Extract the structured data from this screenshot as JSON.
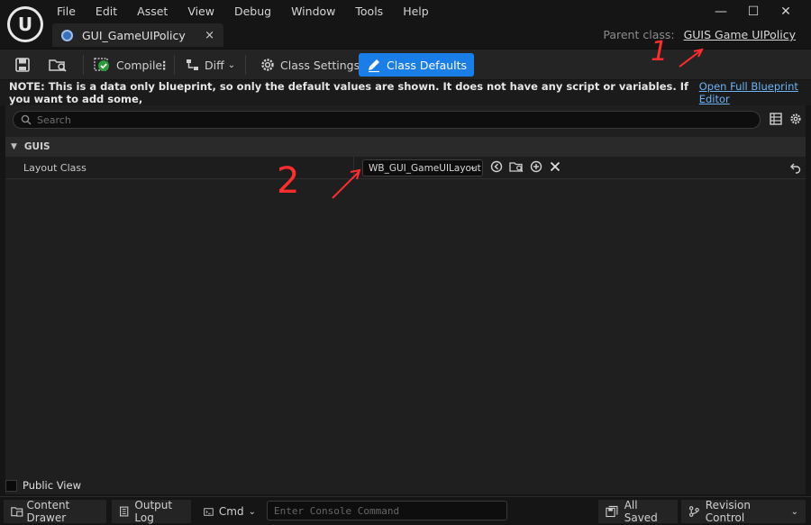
{
  "menu": [
    "File",
    "Edit",
    "Asset",
    "View",
    "Debug",
    "Window",
    "Tools",
    "Help"
  ],
  "window_controls": {
    "minimize": "—",
    "maximize": "☐",
    "close": "✕"
  },
  "tab": {
    "label": "GUI_GameUIPolicy",
    "close": "×"
  },
  "parent_class": {
    "label": "Parent class:",
    "value": "GUIS Game UIPolicy"
  },
  "toolbar": {
    "compile_label": "Compile",
    "diff_label": "Diff",
    "class_settings_label": "Class Settings",
    "class_defaults_label": "Class Defaults"
  },
  "note": {
    "text": "NOTE: This is a data only blueprint, so only the default values are shown.  It does not have any script or variables.  If you want to add some,",
    "link": "Open Full Blueprint Editor"
  },
  "details": {
    "search_placeholder": "Search",
    "category": "GUIS",
    "property": {
      "name": "Layout Class",
      "value": "WB_GUI_GameUILayout"
    },
    "public_view_label": "Public View"
  },
  "statusbar": {
    "content_drawer": "Content Drawer",
    "output_log": "Output Log",
    "cmd": "Cmd",
    "console_placeholder": "Enter Console Command",
    "all_saved": "All Saved",
    "revision_control": "Revision Control"
  },
  "annotations": {
    "one": "1",
    "two": "2"
  },
  "colors": {
    "accent": "#1a7ee8",
    "annotation": "#ff2d2d"
  }
}
